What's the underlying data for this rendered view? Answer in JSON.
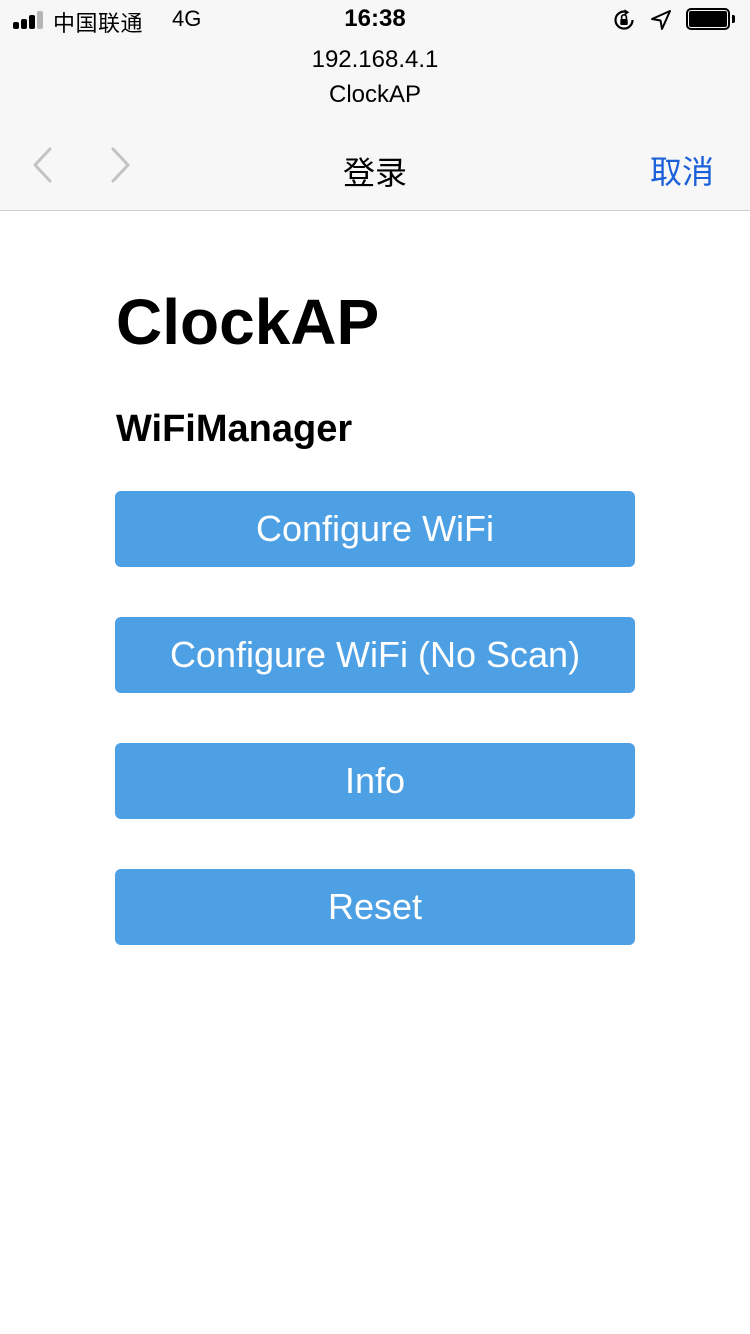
{
  "status_bar": {
    "carrier": "中国联通",
    "network": "4G",
    "time": "16:38",
    "signal_bars_filled": 3,
    "signal_bars_total": 4,
    "battery_level": 1.0,
    "icons": [
      "signal-icon",
      "orientation-lock-icon",
      "location-arrow-icon",
      "battery-icon"
    ]
  },
  "browser": {
    "url": "192.168.4.1",
    "site_title": "ClockAP",
    "nav_title": "登录",
    "cancel_label": "取消",
    "back_icon": "chevron-left-icon",
    "forward_icon": "chevron-right-icon",
    "accent_color": "#1b60d8"
  },
  "page": {
    "heading": "ClockAP",
    "subheading": "WiFiManager",
    "button_color": "#4ea0e4",
    "buttons": [
      {
        "label": "Configure WiFi"
      },
      {
        "label": "Configure WiFi (No Scan)"
      },
      {
        "label": "Info"
      },
      {
        "label": "Reset"
      }
    ]
  }
}
